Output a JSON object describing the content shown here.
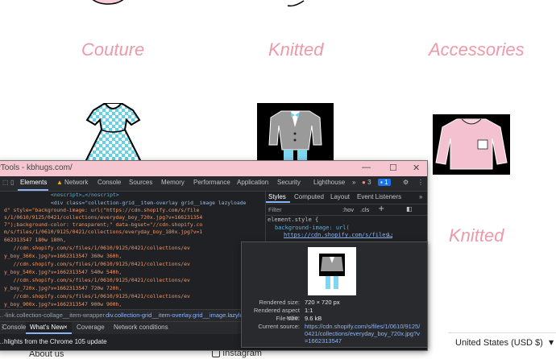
{
  "categories": {
    "couture": "Couture",
    "knitted": "Knitted",
    "accessories": "Accessories",
    "knitted2": "Knitted"
  },
  "devtools": {
    "title": "DevTools - kbhugs.com/",
    "tabs": [
      "Elements",
      "Network",
      "Console",
      "Sources",
      "Memory",
      "Performance",
      "Application",
      "Security",
      "Lighthouse"
    ],
    "more": "»",
    "error_count": "3",
    "message_count": "1",
    "code_lines": [
      "<noscript>…</noscript>",
      "<div class=\"collection-grid__item-overlay grid__image lazyloade",
      "d\" style=\"background-image: url(\"https://cdn.shopify.com/s/file",
      "s/1/0610/9125/0421/collections/everyday_boy_720x.jpg?v=166231354",
      "7\");background-color: transparent;\" data-bgset=\"//cdn.shopify.co",
      "m/s/files/1/0610/9125/0421/collections/everyday_boy_180x.jpg?v=1",
      "662313547 180w 180h,",
      "   //cdn.shopify.com/s/files/1/0610/9125/0421/collections/ev",
      "y_boy_360x.jpg?v=1662313547 360w 360h,",
      "   //cdn.shopify.com/s/files/1/0610/9125/0421/collections/ev",
      "y_boy_540x.jpg?v=1662313547 540w 540h,",
      "   //cdn.shopify.com/s/files/1/0610/9125/0421/collections/ev",
      "y_boy_720x.jpg?v=1662313547 720w 720h,",
      "   //cdn.shopify.com/s/files/1/0610/9125/0421/collections/ev",
      "y_boy_900x.jpg?v=1662313547 900w 900h,"
    ],
    "styles_tabs": [
      "Styles",
      "Computed",
      "Layout",
      "Event Listeners"
    ],
    "styles_more": "»",
    "filter_placeholder": "Filter",
    "hov": ":hov",
    "cls": ".cls",
    "element_style": "element.style {",
    "bg_prop": "background-image: url(",
    "bg_url": "https://cdn.shopify.com/s/files…",
    "bg_end": ");",
    "breadcrumb_left": "…-link.collection-collage__item-wrapper",
    "breadcrumb_right": "div.collection-grid__item-overlay.grid__image.lazyload",
    "drawer_tabs": [
      "Console",
      "What's New",
      "Coverage",
      "Network conditions"
    ],
    "drawer_close": "×",
    "drawer_text": "…hlights from the Chrome 105 update"
  },
  "tooltip": {
    "rendered_size_label": "Rendered size:",
    "rendered_size": "720 × 720 px",
    "aspect_label": "Rendered aspect ratio:",
    "aspect": "1:1",
    "filesize_label": "File size:",
    "filesize": "9.6 kB",
    "source_label": "Current source:",
    "source": "https://cdn.shopify.com/s/files/1/0610/9125/0421/collections/everyday_boy_720x.jpg?v=1662313547"
  },
  "footer": {
    "currency": "United States (USD $)",
    "about": "About us",
    "instagram": "Instagram"
  },
  "colors": {
    "pink_text": "#ec9aaa",
    "devtools_bg": "#202124",
    "devtools_title": "#f5c6cf"
  }
}
